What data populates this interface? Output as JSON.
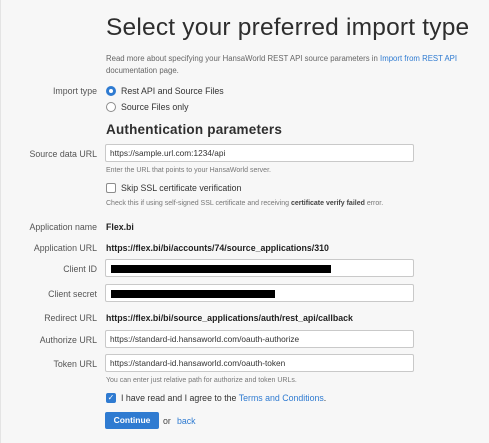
{
  "header": {
    "title": "Select your preferred import type",
    "intro_text": "Read more about specifying your HansaWorld REST API source parameters in ",
    "intro_link": "Import from REST API",
    "intro_suffix": " documentation page."
  },
  "import_type": {
    "label": "Import type",
    "options": [
      "Rest API and Source Files",
      "Source Files only"
    ],
    "selected": "Rest API and Source Files"
  },
  "auth": {
    "heading": "Authentication parameters",
    "source_data_url": {
      "label": "Source data URL",
      "value": "https://sample.url.com:1234/api",
      "hint": "Enter the URL that points to your HansaWorld server."
    },
    "skip_ssl": {
      "label": "Skip SSL certificate verification",
      "checked": false,
      "hint_before": "Check this if using self-signed SSL certificate and receiving ",
      "hint_bold": "certificate verify failed",
      "hint_after": " error."
    },
    "application_name": {
      "label": "Application name",
      "value": "Flex.bi"
    },
    "application_url": {
      "label": "Application URL",
      "value": "https://flex.bi/bi/accounts/74/source_applications/310"
    },
    "client_id": {
      "label": "Client ID",
      "value": ""
    },
    "client_secret": {
      "label": "Client secret",
      "value": ""
    },
    "redirect_url": {
      "label": "Redirect URL",
      "value": "https://flex.bi/bi/source_applications/auth/rest_api/callback"
    },
    "authorize_url": {
      "label": "Authorize URL",
      "value": "https://standard-id.hansaworld.com/oauth-authorize"
    },
    "token_url": {
      "label": "Token URL",
      "value": "https://standard-id.hansaworld.com/oauth-token",
      "hint": "You can enter just relative path for authorize and token URLs."
    }
  },
  "terms": {
    "checked": true,
    "text": "I have read and I agree to the ",
    "link": "Terms and Conditions",
    "suffix": "."
  },
  "actions": {
    "continue_label": "Continue",
    "or_label": "or",
    "back_label": "back"
  },
  "colors": {
    "accent": "#2f7bd1",
    "redaction": "#000000"
  }
}
